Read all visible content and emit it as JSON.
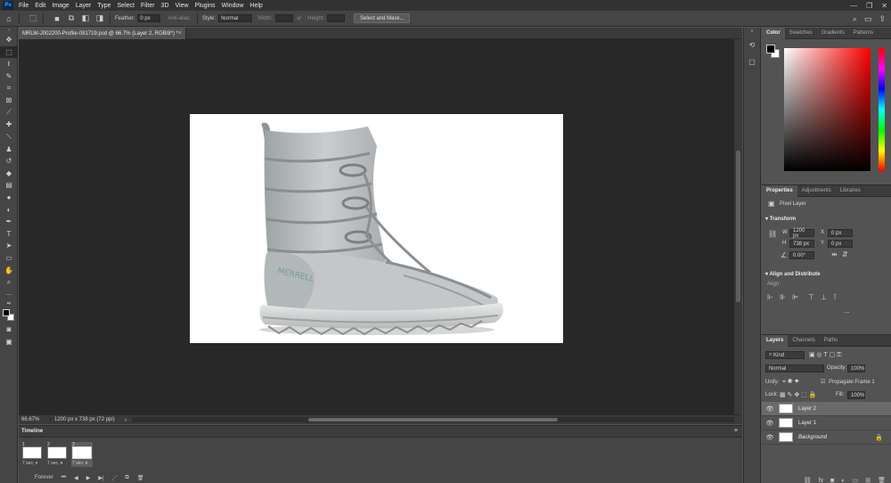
{
  "app": {
    "logo": "Ps",
    "menus": [
      "File",
      "Edit",
      "Image",
      "Layer",
      "Type",
      "Select",
      "Filter",
      "3D",
      "View",
      "Plugins",
      "Window",
      "Help"
    ],
    "window_controls": [
      "—",
      "❐",
      "✕"
    ]
  },
  "options": {
    "feather_label": "Feather:",
    "feather_value": "0 px",
    "antialias_label": "Anti-alias",
    "style_label": "Style:",
    "style_value": "Normal",
    "width_label": "Width:",
    "height_label": "Height:",
    "select_mask_label": "Select and Mask...",
    "icons": [
      "home-icon",
      "marquee-icon",
      "new-selection-icon",
      "add-selection-icon",
      "subtract-selection-icon",
      "intersect-selection-icon"
    ]
  },
  "document": {
    "tab_title": "MRLW-J002200-Profile-091719.psd @ 66.7% (Layer 2, RGB/8*) *",
    "zoom": "66.67%",
    "size": "1200 px x 738 px (72 ppi)"
  },
  "toolbar": {
    "tools": [
      "move-tool",
      "marquee-tool",
      "lasso-tool",
      "quick-select-tool",
      "crop-tool",
      "frame-tool",
      "eyedropper-tool",
      "healing-tool",
      "brush-tool",
      "stamp-tool",
      "history-brush-tool",
      "eraser-tool",
      "gradient-tool",
      "blur-tool",
      "dodge-tool",
      "pen-tool",
      "type-tool",
      "path-select-tool",
      "rectangle-tool",
      "hand-tool",
      "zoom-tool",
      "more-tools"
    ]
  },
  "timeline": {
    "title": "Timeline",
    "frames": [
      {
        "num": "1",
        "delay": "7 sec. ▾"
      },
      {
        "num": "2",
        "delay": "7 sec. ▾"
      },
      {
        "num": "3",
        "delay": "7 sec. ▾"
      }
    ],
    "loop": "Forever"
  },
  "color_panel": {
    "tabs": [
      "Color",
      "Swatches",
      "Gradients",
      "Patterns"
    ]
  },
  "properties": {
    "tabs": [
      "Properties",
      "Adjustments",
      "Libraries"
    ],
    "kind": "Pixel Layer",
    "transform_title": "Transform",
    "w_label": "W",
    "w_value": "1200 px",
    "h_label": "H",
    "h_value": "738 px",
    "x_label": "X",
    "x_value": "0 px",
    "y_label": "Y",
    "y_value": "0 px",
    "angle_value": "0.00°",
    "align_title": "Align and Distribute",
    "align_label": "Align:",
    "more": "..."
  },
  "layers": {
    "tabs": [
      "Layers",
      "Channels",
      "Paths"
    ],
    "filter_kind": "Kind",
    "blend_mode": "Normal",
    "opacity_label": "Opacity:",
    "opacity_value": "100%",
    "unify_label": "Unify:",
    "propagate_label": "Propagate Frame 1",
    "lock_label": "Lock:",
    "fill_label": "Fill:",
    "fill_value": "100%",
    "items": [
      {
        "name": "Layer 2",
        "selected": true
      },
      {
        "name": "Layer 1",
        "selected": false
      },
      {
        "name": "Background",
        "selected": false
      }
    ]
  }
}
